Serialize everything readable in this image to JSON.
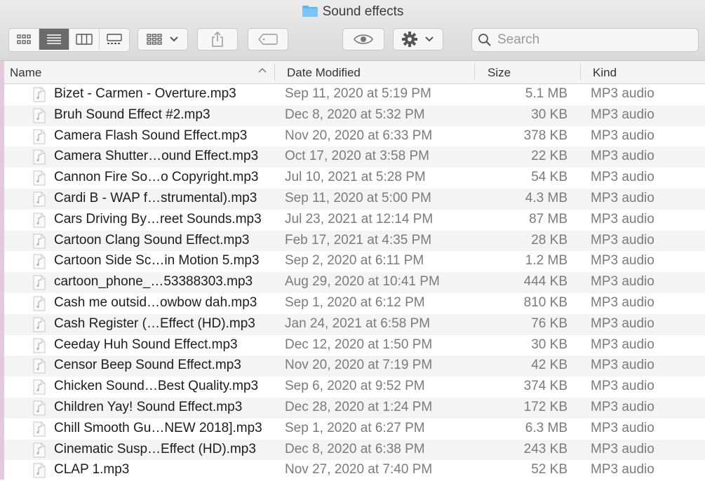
{
  "window": {
    "title": "Sound effects"
  },
  "toolbar": {
    "view_modes": [
      "icon-view",
      "list-view",
      "column-view",
      "gallery-view"
    ],
    "active_view": "list-view"
  },
  "search": {
    "placeholder": "Search"
  },
  "columns": {
    "name": "Name",
    "date": "Date Modified",
    "size": "Size",
    "kind": "Kind"
  },
  "files": [
    {
      "name": "Bizet - Carmen - Overture.mp3",
      "date": "Sep 11, 2020 at 5:19 PM",
      "size": "5.1 MB",
      "kind": "MP3 audio"
    },
    {
      "name": "Bruh Sound Effect #2.mp3",
      "date": "Dec 8, 2020 at 5:32 PM",
      "size": "30 KB",
      "kind": "MP3 audio"
    },
    {
      "name": "Camera Flash Sound Effect.mp3",
      "date": "Nov 20, 2020 at 6:33 PM",
      "size": "378 KB",
      "kind": "MP3 audio"
    },
    {
      "name": "Camera Shutter…ound Effect.mp3",
      "date": "Oct 17, 2020 at 3:58 PM",
      "size": "22 KB",
      "kind": "MP3 audio"
    },
    {
      "name": "Cannon Fire So…o Copyright.mp3",
      "date": "Jul 10, 2021 at 5:28 PM",
      "size": "54 KB",
      "kind": "MP3 audio"
    },
    {
      "name": "Cardi B - WAP f…strumental).mp3",
      "date": "Sep 11, 2020 at 5:00 PM",
      "size": "4.3 MB",
      "kind": "MP3 audio"
    },
    {
      "name": "Cars Driving By…reet Sounds.mp3",
      "date": "Jul 23, 2021 at 12:14 PM",
      "size": "87 MB",
      "kind": "MP3 audio"
    },
    {
      "name": "Cartoon Clang Sound Effect.mp3",
      "date": "Feb 17, 2021 at 4:35 PM",
      "size": "28 KB",
      "kind": "MP3 audio"
    },
    {
      "name": "Cartoon Side Sc…in Motion 5.mp3",
      "date": "Sep 2, 2020 at 6:11 PM",
      "size": "1.2 MB",
      "kind": "MP3 audio"
    },
    {
      "name": "cartoon_phone_…53388303.mp3",
      "date": "Aug 29, 2020 at 10:41 PM",
      "size": "444 KB",
      "kind": "MP3 audio"
    },
    {
      "name": "Cash me outsid…owbow dah.mp3",
      "date": "Sep 1, 2020 at 6:12 PM",
      "size": "810 KB",
      "kind": "MP3 audio"
    },
    {
      "name": "Cash Register (…Effect (HD).mp3",
      "date": "Jan 24, 2021 at 6:58 PM",
      "size": "76 KB",
      "kind": "MP3 audio"
    },
    {
      "name": "Ceeday Huh Sound Effect.mp3",
      "date": "Dec 12, 2020 at 1:50 PM",
      "size": "30 KB",
      "kind": "MP3 audio"
    },
    {
      "name": "Censor Beep Sound Effect.mp3",
      "date": "Nov 20, 2020 at 7:19 PM",
      "size": "42 KB",
      "kind": "MP3 audio"
    },
    {
      "name": "Chicken Sound…Best Quality.mp3",
      "date": "Sep 6, 2020 at 9:52 PM",
      "size": "374 KB",
      "kind": "MP3 audio"
    },
    {
      "name": "Children Yay! Sound Effect.mp3",
      "date": "Dec 28, 2020 at 1:24 PM",
      "size": "172 KB",
      "kind": "MP3 audio"
    },
    {
      "name": "Chill Smooth Gu…NEW 2018].mp3",
      "date": "Sep 1, 2020 at 6:27 PM",
      "size": "6.3 MB",
      "kind": "MP3 audio"
    },
    {
      "name": "Cinematic Susp…Effect (HD).mp3",
      "date": "Dec 8, 2020 at 6:38 PM",
      "size": "243 KB",
      "kind": "MP3 audio"
    },
    {
      "name": "CLAP 1.mp3",
      "date": "Nov 27, 2020 at 7:40 PM",
      "size": "52 KB",
      "kind": "MP3 audio"
    }
  ]
}
